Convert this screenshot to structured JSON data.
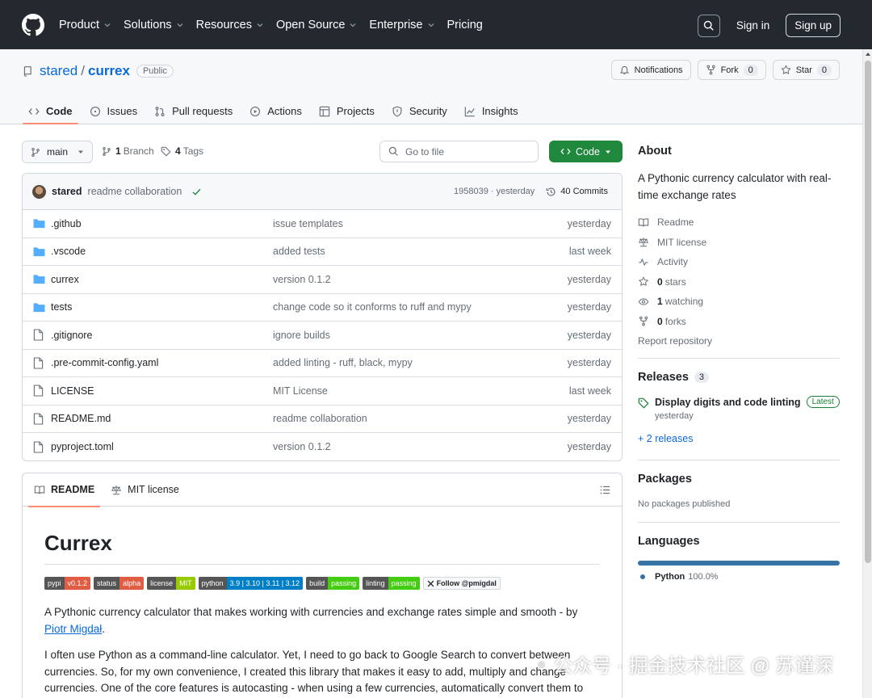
{
  "header": {
    "nav": [
      "Product",
      "Solutions",
      "Resources",
      "Open Source",
      "Enterprise",
      "Pricing"
    ],
    "sign_in": "Sign in",
    "sign_up": "Sign up"
  },
  "repo": {
    "owner": "stared",
    "name": "currex",
    "visibility": "Public",
    "notifications_label": "Notifications",
    "fork_label": "Fork",
    "fork_count": "0",
    "star_label": "Star",
    "star_count": "0",
    "tabs": [
      "Code",
      "Issues",
      "Pull requests",
      "Actions",
      "Projects",
      "Security",
      "Insights"
    ]
  },
  "toolbar": {
    "branch": "main",
    "branch_count": "1",
    "branch_label": "Branch",
    "tag_count": "4",
    "tag_label": "Tags",
    "goto_placeholder": "Go to file",
    "code_button": "Code"
  },
  "last_commit": {
    "author": "stared",
    "message": "readme collaboration",
    "hash_time": "1958039 · yesterday",
    "commits": "40 Commits"
  },
  "files": [
    {
      "type": "dir",
      "name": ".github",
      "commit": "issue templates",
      "time": "yesterday"
    },
    {
      "type": "dir",
      "name": ".vscode",
      "commit": "added tests",
      "time": "last week"
    },
    {
      "type": "dir",
      "name": "currex",
      "commit": "version 0.1.2",
      "time": "yesterday"
    },
    {
      "type": "dir",
      "name": "tests",
      "commit": "change code so it conforms to ruff and mypy",
      "time": "yesterday"
    },
    {
      "type": "file",
      "name": ".gitignore",
      "commit": "ignore builds",
      "time": "yesterday"
    },
    {
      "type": "file",
      "name": ".pre-commit-config.yaml",
      "commit": "added linting - ruff, black, mypy",
      "time": "yesterday"
    },
    {
      "type": "file",
      "name": "LICENSE",
      "commit": "MIT License",
      "time": "last week"
    },
    {
      "type": "file",
      "name": "README.md",
      "commit": "readme collaboration",
      "time": "yesterday"
    },
    {
      "type": "file",
      "name": "pyproject.toml",
      "commit": "version 0.1.2",
      "time": "yesterday"
    }
  ],
  "readme": {
    "tab_readme": "README",
    "tab_license": "MIT license",
    "title": "Currex",
    "badges": [
      {
        "k": "pypi",
        "v": "v0.1.2",
        "color": "#e05d44"
      },
      {
        "k": "status",
        "v": "alpha",
        "color": "#e05d44"
      },
      {
        "k": "license",
        "v": "MIT",
        "color": "#97ca00"
      },
      {
        "k": "python",
        "v": "3.9 | 3.10 | 3.11 | 3.12",
        "color": "#007ec6"
      },
      {
        "k": "build",
        "v": "passing",
        "color": "#4c1"
      },
      {
        "k": "linting",
        "v": "passing",
        "color": "#4c1"
      }
    ],
    "follow_badge": "Follow @pmigdal",
    "p1_text": "A Pythonic currency calculator that makes working with currencies and exchange rates simple and smooth - by",
    "p1_link": "Piotr Migdał",
    "p1_end": ".",
    "p2": "I often use Python as a command-line calculator. Yet, I need to go back to Google Search to convert between currencies. So, for my own convenience, I created this library that makes it easy to add, multiply and change currencies. One of the core features is autocasting - when using a few currencies, automatically convert them to"
  },
  "about": {
    "heading": "About",
    "description": "A Pythonic currency calculator with real-time exchange rates",
    "readme": "Readme",
    "license": "MIT license",
    "activity": "Activity",
    "stars_count": "0",
    "stars_label": "stars",
    "watching_count": "1",
    "watching_label": "watching",
    "forks_count": "0",
    "forks_label": "forks",
    "report": "Report repository"
  },
  "releases": {
    "heading": "Releases",
    "count": "3",
    "latest_name": "Display digits and code linting",
    "latest_badge": "Latest",
    "latest_time": "yesterday",
    "more": "+ 2 releases"
  },
  "packages": {
    "heading": "Packages",
    "empty": "No packages published"
  },
  "languages": {
    "heading": "Languages",
    "items": [
      {
        "name": "Python",
        "percent": "100.0%",
        "color": "#3572A5",
        "share": 1.0
      }
    ]
  },
  "watermark": "公众号 · 掘金技术社区 @ 苏谨深"
}
